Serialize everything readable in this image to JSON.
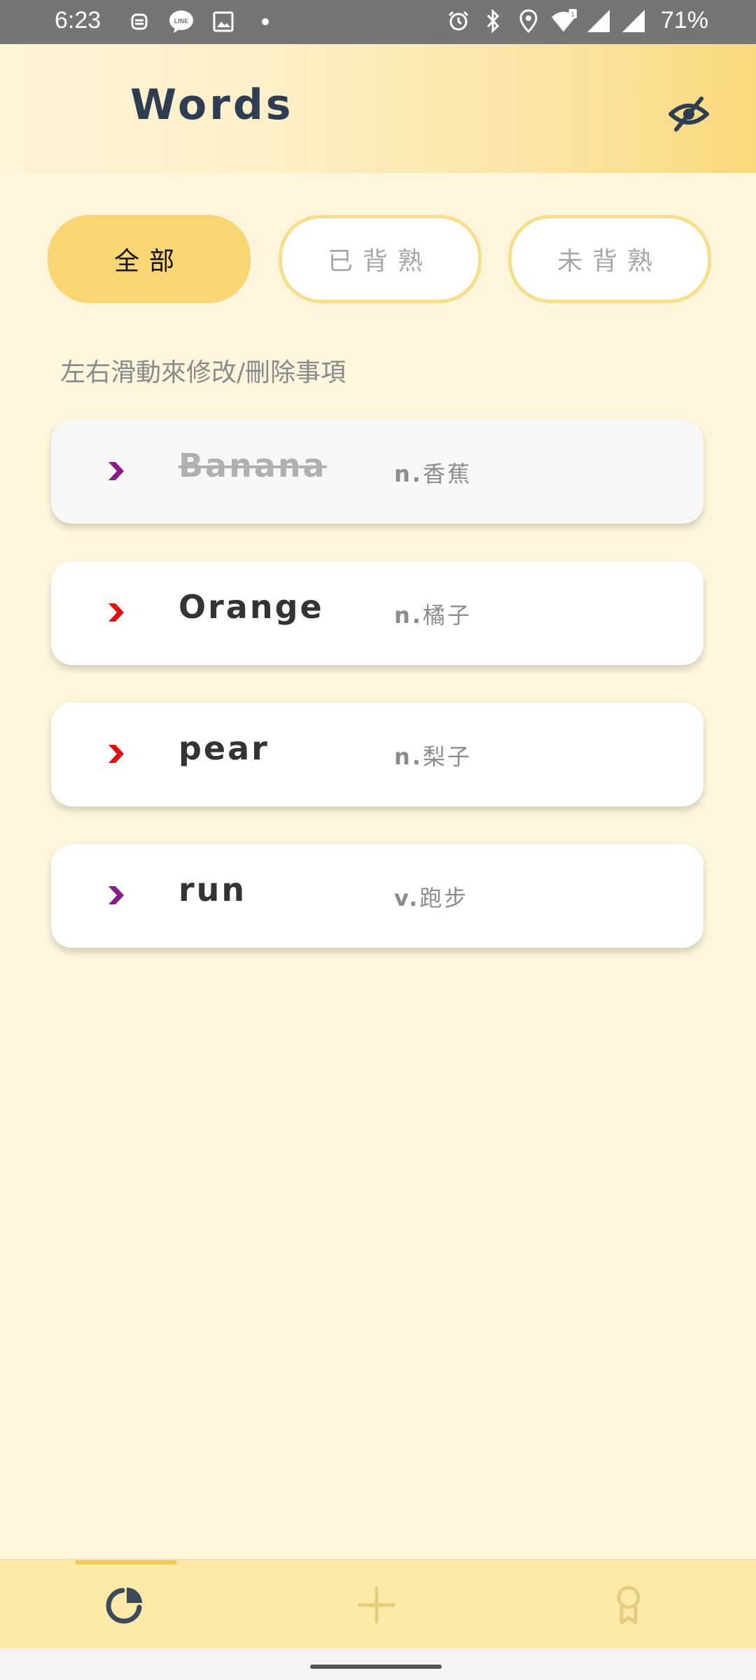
{
  "status_bar": {
    "time": "6:23",
    "battery": "71%",
    "left_icons": [
      "robot-notification-icon",
      "line-chat-icon",
      "gallery-icon",
      "dot-icon"
    ],
    "right_icons": [
      "alarm-icon",
      "bluetooth-icon",
      "location-icon",
      "wifi-icon",
      "signal-icon",
      "signal-icon"
    ]
  },
  "header": {
    "title": "Words",
    "toggle_icon": "eye-off-icon"
  },
  "filters": {
    "items": [
      {
        "label": "全部",
        "active": true
      },
      {
        "label": "已背熟",
        "active": false
      },
      {
        "label": "未背熟",
        "active": false
      }
    ]
  },
  "hint": "左右滑動來修改/刪除事項",
  "words": [
    {
      "word": "Banana",
      "pos": "n.",
      "meaning": "香蕉",
      "done": true,
      "chevron_color": "#8b1a8b"
    },
    {
      "word": "Orange",
      "pos": "n.",
      "meaning": "橘子",
      "done": false,
      "chevron_color": "#e01010"
    },
    {
      "word": "pear",
      "pos": "n.",
      "meaning": "梨子",
      "done": false,
      "chevron_color": "#e01010"
    },
    {
      "word": "run",
      "pos": "v.",
      "meaning": "跑步",
      "done": false,
      "chevron_color": "#8b1a8b"
    }
  ],
  "bottom_nav": {
    "items": [
      {
        "icon": "pie-chart-icon",
        "active": true
      },
      {
        "icon": "add-icon",
        "active": false
      },
      {
        "icon": "award-icon",
        "active": false
      }
    ]
  },
  "colors": {
    "accent": "#f9d674",
    "background": "#fdf6dc",
    "title": "#2e3d52"
  }
}
